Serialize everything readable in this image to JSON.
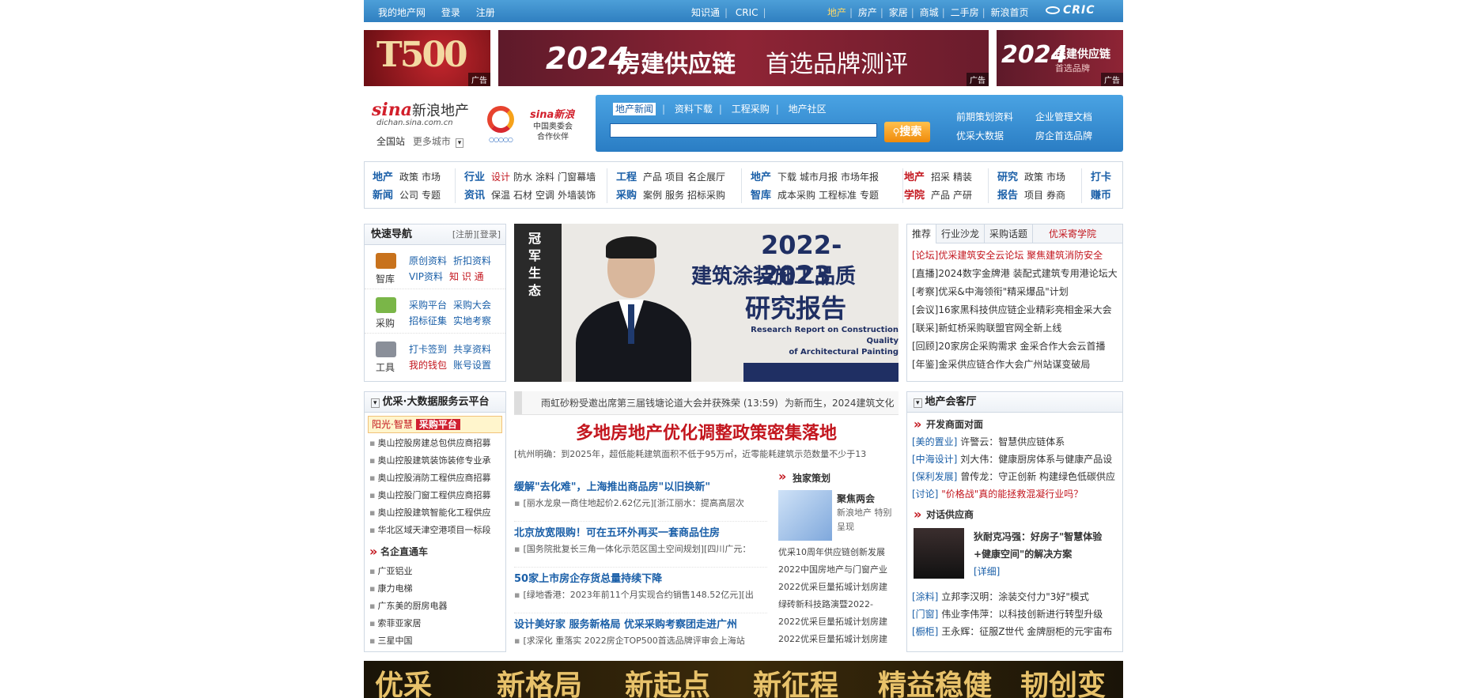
{
  "topbar": {
    "left": [
      "我的地产网",
      "登录",
      "注册"
    ],
    "middle": [
      "知识通",
      "CRIC"
    ],
    "right": [
      "地产",
      "房产",
      "家居",
      "商城",
      "二手房",
      "新浪首页"
    ],
    "logo": "CRIC"
  },
  "ads": {
    "tag": "广告",
    "ad1_big": "T500",
    "ad2_year": "2024",
    "ad2_title": "房建供应链",
    "ad2_sub": "首选品牌测评",
    "ad3_year": "2024",
    "ad3_title": "房建供应链",
    "ad3_sub": "首选品牌"
  },
  "header": {
    "sina_mark": "sina",
    "sina_name": "新浪地产",
    "domain": "dichan.sina.com.cn",
    "city": "全国站",
    "more_cities": "更多城市",
    "partner_brand": "sina新浪",
    "partner_line1": "中国奥委会",
    "partner_line2": "合作伙伴"
  },
  "search": {
    "tabs": [
      "地产新闻",
      "资料下载",
      "工程采购",
      "地产社区"
    ],
    "button": "搜索",
    "value": "",
    "links": [
      "前期策划资料",
      "企业管理文档",
      "优采大数据",
      "房企首选品牌"
    ]
  },
  "catnav": {
    "groups": [
      {
        "h": [
          "地产",
          "新闻"
        ],
        "items": [
          [
            "政策",
            "市场"
          ],
          [
            "公司",
            "专题"
          ]
        ]
      },
      {
        "h": [
          "行业",
          "资讯"
        ],
        "items": [
          [
            "设计",
            "防水",
            "涂料",
            "门窗幕墙"
          ],
          [
            "保温",
            "石材",
            "空调",
            "外墙装饰"
          ]
        ]
      },
      {
        "h": [
          "工程",
          "采购"
        ],
        "items": [
          [
            "产品",
            "项目",
            "名企展厅"
          ],
          [
            "案例",
            "服务",
            "招标采购"
          ]
        ]
      },
      {
        "h": [
          "地产",
          "智库"
        ],
        "items": [
          [
            "下载",
            "城市月报",
            "市场年报"
          ],
          [
            "成本采购",
            "工程标准",
            "专题"
          ]
        ]
      },
      {
        "h": [
          "地产",
          "学院"
        ],
        "items": [
          [
            "招采",
            "精装"
          ],
          [
            "产品",
            "产研"
          ]
        ]
      },
      {
        "h": [
          "研究",
          "报告"
        ],
        "items": [
          [
            "政策",
            "市场"
          ],
          [
            "项目",
            "券商"
          ]
        ]
      },
      {
        "h": [
          "打卡",
          "赚币"
        ],
        "items": []
      }
    ]
  },
  "quicknav": {
    "title": "快速导航",
    "reg": "[注册][登录]",
    "rows": [
      {
        "cap": "智库",
        "links": [
          "原创资料",
          "折扣资料",
          "VIP资料",
          "知 识 通"
        ]
      },
      {
        "cap": "采购",
        "links": [
          "采购平台",
          "采购大会",
          "招标征集",
          "实地考察"
        ]
      },
      {
        "cap": "工具",
        "links": [
          "打卡签到",
          "共享资料",
          "我的钱包",
          "账号设置"
        ]
      }
    ]
  },
  "hero": {
    "strip": "冠军生态",
    "year": "2022-2023",
    "title1": "建筑涂装施工品质",
    "title2": "研究报告",
    "en1": "Research Report on Construction Quality",
    "en2": "of Architectural Painting"
  },
  "tabs_right": {
    "tabs": [
      "推荐",
      "行业沙龙",
      "采购话题",
      "优采寄学院"
    ],
    "items": [
      "[论坛]优采建筑安全云论坛 聚焦建筑消防安全",
      "[直播]2024数字金牌港 装配式建筑专用港论坛大",
      "[考察]优采&中海领衔\"精采爆品\"计划",
      "[会议]16家黑科技供应链企业精彩亮相金采大会",
      "[联采]新虹桥采购联盟官网全新上线",
      "[回顾]20家房企采购需求 金采合作大会云首播",
      "[年鉴]金采供应链合作大会广州站谋变破局"
    ]
  },
  "ticker": {
    "item1": "雨虹砂粉受邀出席第三届钱塘论道大会并获殊荣 (13:59)",
    "item2": "为新而生，2024建筑文化"
  },
  "main_news": {
    "headline": "多地房地产优化调整政策密集落地",
    "subline": "[杭州明确：到2025年，超低能耗建筑面积不低于95万㎡，近零能耗建筑示范数量不少于13",
    "items": [
      {
        "t": "缓解\"去化难\"，上海推出商品房\"以旧换新\"",
        "s": "[丽水龙泉一商住地起价2.62亿元][浙江丽水：提高高层次"
      },
      {
        "t": "北京放宽限购！可在五环外再买一套商品住房",
        "s": "[国务院批复长三角一体化示范区国土空间规划][四川广元："
      },
      {
        "t": "50家上市房企存货总量持续下降",
        "s": "[绿地香港：2023年前11个月实现合约销售148.52亿元][出"
      },
      {
        "t": "设计美好家 服务新格局 优采采购考察团走进广州",
        "s": "[求深化 重落实 2022房企TOP500首选品牌评审会上海站"
      }
    ]
  },
  "exclusive": {
    "title": "独家策划",
    "cap": "聚焦两会",
    "sub": "新浪地产 特别呈现",
    "list": [
      "优采10周年供应链创新发展",
      "2022中国房地产与门窗产业",
      "2022优采巨量拓城计划房建",
      "绿砖新科技路演暨2022-",
      "2022优采巨量拓城计划房建",
      "2022优采巨量拓城计划房建"
    ]
  },
  "platform": {
    "title": "优采·大数据服务云平台",
    "banner1": "阳光·智慧",
    "banner2": "采购平台",
    "list": [
      "奥山控股房建总包供应商招募",
      "奥山控股建筑装饰装修专业承",
      "奥山控股消防工程供应商招募",
      "奥山控股门窗工程供应商招募",
      "奥山控股建筑智能化工程供应",
      "华北区域天津空港项目一标段"
    ],
    "sub_title": "名企直通车",
    "companies": [
      "广亚铝业",
      "康力电梯",
      "广东美的厨房电器",
      "索菲亚家居",
      "三星中国"
    ]
  },
  "hall": {
    "title": "地产会客厅",
    "sec1": "开发商面对面",
    "list1": [
      {
        "b": "[美的置业]",
        "t": " 许警云：智慧供应链体系"
      },
      {
        "b": "[中海设计]",
        "t": " 刘大伟：健康厨房体系与健康产品设"
      },
      {
        "b": "[保利发展]",
        "t": " 曾传龙：守正创新 构建绿色低碳供应"
      },
      {
        "b": "[讨论]",
        "t": " \"价格战\"真的能拯救混凝行业吗？"
      }
    ],
    "sec2": "对话供应商",
    "feat": "狄耐克冯强：好房子\"智慧体验+健康空间\"的解决方案",
    "feat_more": "[详细]",
    "list2": [
      {
        "b": "[涂料]",
        "t": " 立邦李汉明：涂装交付力\"3好\"模式"
      },
      {
        "b": "[门窗]",
        "t": " 伟业李伟萍：以科技创新进行转型升级"
      },
      {
        "b": "[橱柜]",
        "t": " 王永辉：征服Z世代 金牌厨柜的元宇宙布"
      }
    ]
  },
  "bottom_ad": [
    "优采",
    "新格局",
    "新起点",
    "新征程",
    "精益稳健",
    "韧创变"
  ]
}
